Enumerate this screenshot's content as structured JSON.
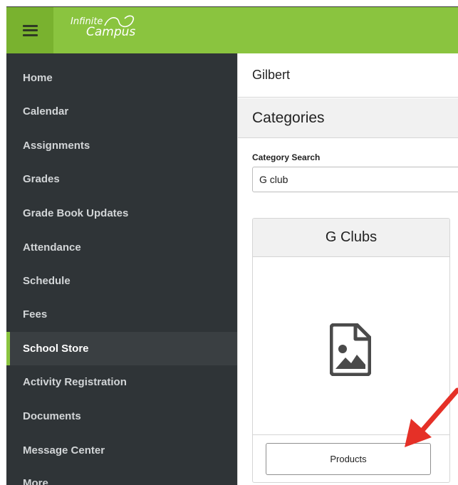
{
  "header": {
    "logo_line1": "Infinite",
    "logo_line2": "Campus",
    "menu_icon": "hamburger-icon",
    "brand_color": "#8ac43f"
  },
  "sidebar": {
    "items": [
      {
        "label": "Home"
      },
      {
        "label": "Calendar"
      },
      {
        "label": "Assignments"
      },
      {
        "label": "Grades"
      },
      {
        "label": "Grade Book Updates"
      },
      {
        "label": "Attendance"
      },
      {
        "label": "Schedule"
      },
      {
        "label": "Fees"
      },
      {
        "label": "School Store",
        "active": true
      },
      {
        "label": "Activity Registration"
      },
      {
        "label": "Documents"
      },
      {
        "label": "Message Center"
      },
      {
        "label": "More"
      }
    ]
  },
  "main": {
    "school_name": "Gilbert",
    "section_title": "Categories",
    "search": {
      "label": "Category Search",
      "value": "G club"
    },
    "card": {
      "title": "G Clubs",
      "image_icon": "image-placeholder-icon",
      "button_label": "Products"
    }
  },
  "annotation": {
    "arrow_icon": "red-arrow-icon",
    "color": "#e53027"
  }
}
